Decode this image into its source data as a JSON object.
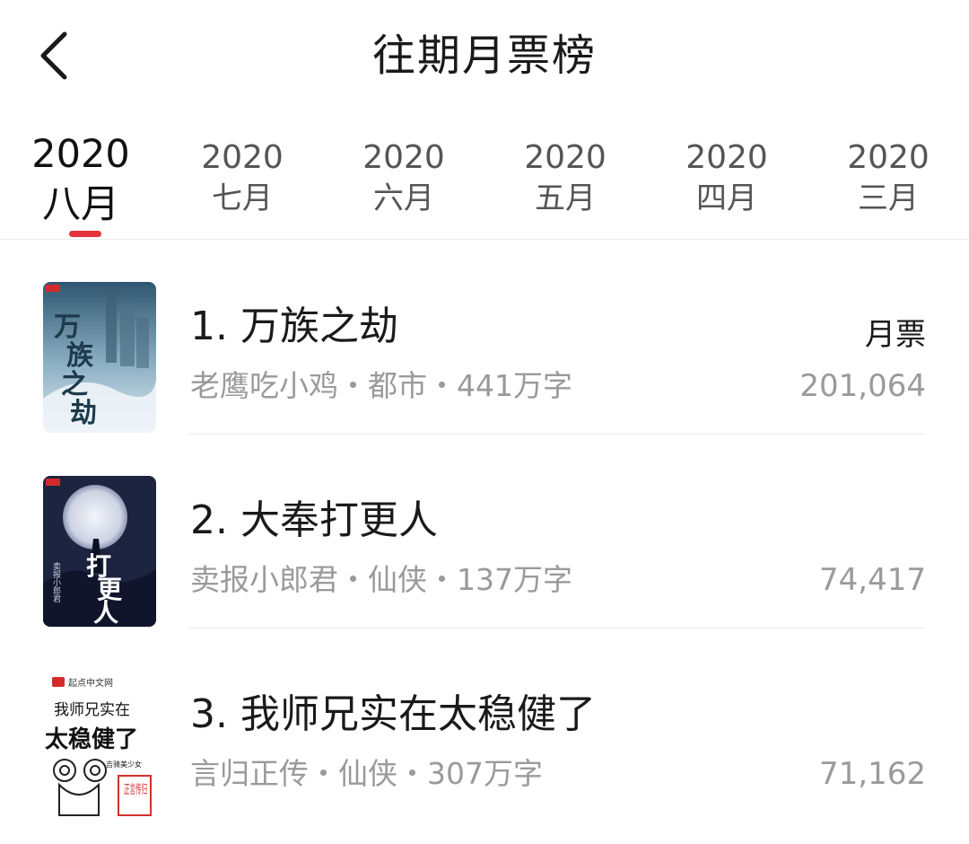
{
  "header": {
    "title": "往期月票榜"
  },
  "tabs": [
    {
      "year": "2020",
      "month": "八月"
    },
    {
      "year": "2020",
      "month": "七月"
    },
    {
      "year": "2020",
      "month": "六月"
    },
    {
      "year": "2020",
      "month": "五月"
    },
    {
      "year": "2020",
      "month": "四月"
    },
    {
      "year": "2020",
      "month": "三月"
    }
  ],
  "active_tab": 0,
  "vote_label": "月票",
  "books": [
    {
      "title": "1. 万族之劫",
      "meta": "老鹰吃小鸡・都市・441万字",
      "votes": "201,064",
      "cover": {
        "text": "万族之劫",
        "bg": "#7fa3b8",
        "accent": "#dce9f0",
        "ink": "#1d3a4c"
      }
    },
    {
      "title": "2. 大奉打更人",
      "meta": "卖报小郎君・仙侠・137万字",
      "votes": "74,417",
      "cover": {
        "text": "打更人",
        "sub": "卖报小郎君",
        "bg": "#1d2440",
        "accent": "#dfe3ee",
        "ink": "#ffffff"
      }
    },
    {
      "title": "3. 我师兄实在太稳健了",
      "meta": "言归正传・仙侠・307万字",
      "votes": "71,162",
      "cover": {
        "brand": "起点中文网",
        "line1": "我师兄实在",
        "line2": "太稳健了",
        "tag": "吉骑美少女",
        "seal": "正言传归",
        "bg": "#ffffff",
        "ink": "#111111",
        "seal_color": "#d0302e"
      }
    }
  ],
  "colors": {
    "accent": "#e4333d",
    "muted": "#9a9a9a",
    "text": "#1a1a1a"
  }
}
